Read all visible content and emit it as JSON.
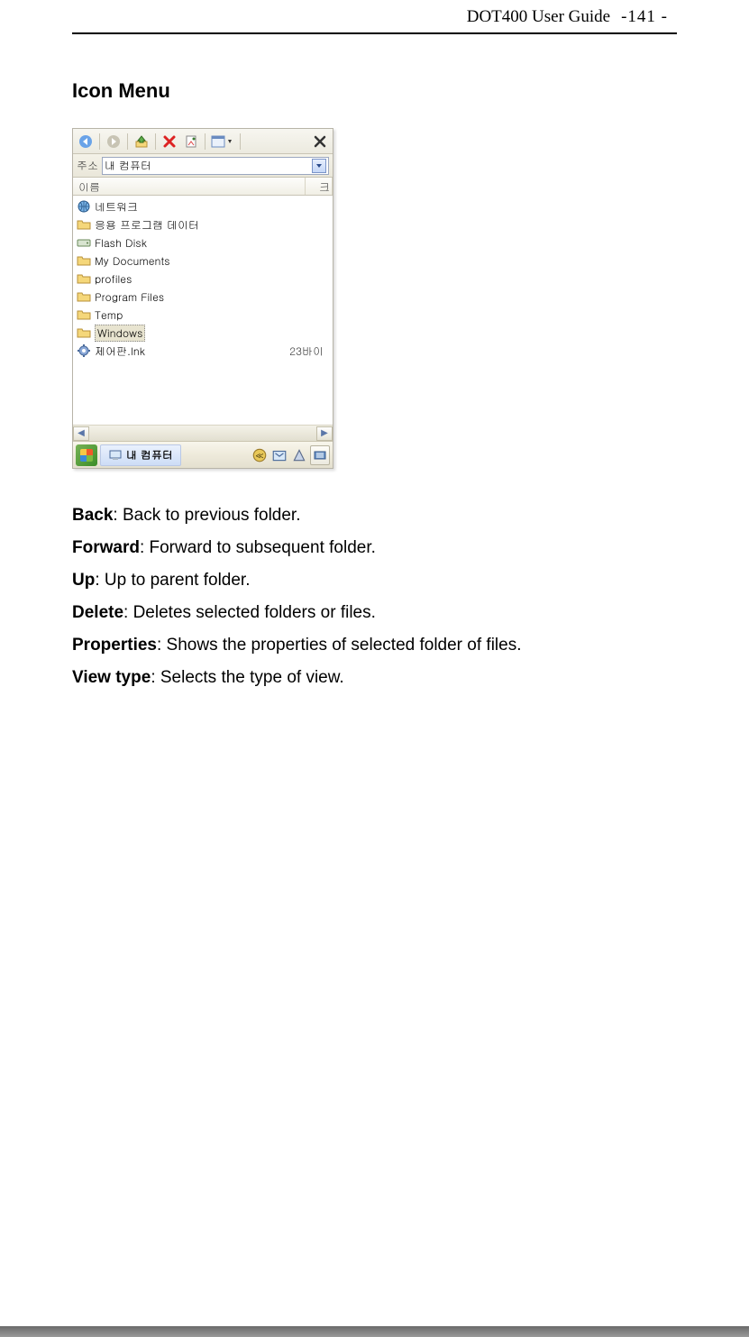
{
  "header": {
    "title": "DOT400 User Guide",
    "pagenum": "-141 -"
  },
  "section_title": "Icon Menu",
  "screenshot": {
    "addr_label": "주소",
    "addr_value": "내 컴퓨터",
    "col1": "이름",
    "col2": "크",
    "items": [
      {
        "name": "네트워크",
        "icon": "globe",
        "size": ""
      },
      {
        "name": "응용 프로그램 데이터",
        "icon": "folder",
        "size": ""
      },
      {
        "name": "Flash Disk",
        "icon": "drive",
        "size": ""
      },
      {
        "name": "My Documents",
        "icon": "folder",
        "size": ""
      },
      {
        "name": "profiles",
        "icon": "folder",
        "size": ""
      },
      {
        "name": "Program Files",
        "icon": "folder",
        "size": ""
      },
      {
        "name": "Temp",
        "icon": "folder",
        "size": ""
      },
      {
        "name": "Windows",
        "icon": "folder",
        "size": "",
        "selected": true
      },
      {
        "name": "제어판.lnk",
        "icon": "gear",
        "size": "23바이"
      }
    ],
    "task_label": "내 컴퓨터"
  },
  "definitions": [
    {
      "term": "Back",
      "desc": ": Back to previous folder."
    },
    {
      "term": "Forward",
      "desc": ": Forward to subsequent folder."
    },
    {
      "term": "Up",
      "desc": ": Up to parent folder."
    },
    {
      "term": "Delete",
      "desc": ": Deletes selected folders or files."
    },
    {
      "term": "Properties",
      "desc": ": Shows the properties of selected folder of files."
    },
    {
      "term": "View type",
      "desc": ": Selects the type of view."
    }
  ]
}
